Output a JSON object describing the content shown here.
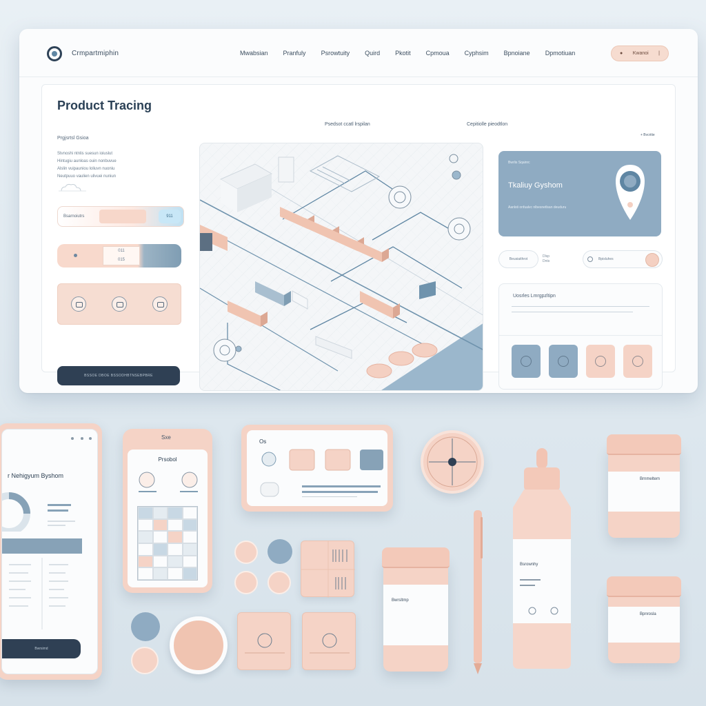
{
  "app": {
    "brand": "Crmpartmiphin",
    "nav": [
      "Mwabsian",
      "Pranfuly",
      "Psrowtuity",
      "Quird",
      "Pkotit",
      "Cpmoua",
      "Cyphsim",
      "Bpnoiane",
      "Dpmotiuan"
    ],
    "nav_button": "Kwanoi"
  },
  "main": {
    "title": "Product Tracing",
    "subhead": "Prgjsrtsl Gsioa",
    "para_lines": [
      "Stvnoshi ntnlis suesun ioiuslut",
      "Hintugiu aunloas ouin nonbuvue",
      "Alslin vuipauniou loliuvn nuoniu",
      "Neutpuuo vaulien ulivuei nuniun"
    ],
    "field_label": "Bsarnoiutrs",
    "field_value": "911",
    "field2_top": "011",
    "field2_bottom": "015",
    "cta": "BSSOE  DBOE  BSSODHBTNSEBPBRE",
    "col_head_a": "Psedsot ccatl lrspilan",
    "col_head_b": "Cepitiolle pieodtlon",
    "top_right_link": "+ Bvcritie"
  },
  "side": {
    "card_small": "Bwrlis Sqainrc",
    "card_title": "Tkaliuy Gyshom",
    "card_desc": "Aanlsti onfualvc nlbesnetlsan deuduru",
    "pill_a": "Beusiaithrot",
    "pill_b_1": "Dlsp",
    "pill_b_2": "Dnts",
    "pill_c": "Bpisluhes",
    "panel_title": "Uosrles Lmrgpzltipn"
  },
  "bottom": {
    "tablet_title": "r Nehigyum Byshom",
    "tablet_cta": "Bwrsimd",
    "phone_label": "Prsobol",
    "phone_cam": "Sxe",
    "device_label": "Os",
    "jar1_label": "Bwrsltmp",
    "bottle_label": "Bsrownhy",
    "jar2_label": "Brnmeltem",
    "jar3_label": "Bpnrosla"
  },
  "colors": {
    "navy": "#2f4054",
    "blue": "#8fabc2",
    "peach": "#f5d3c6",
    "rail": "#5f86a3"
  }
}
